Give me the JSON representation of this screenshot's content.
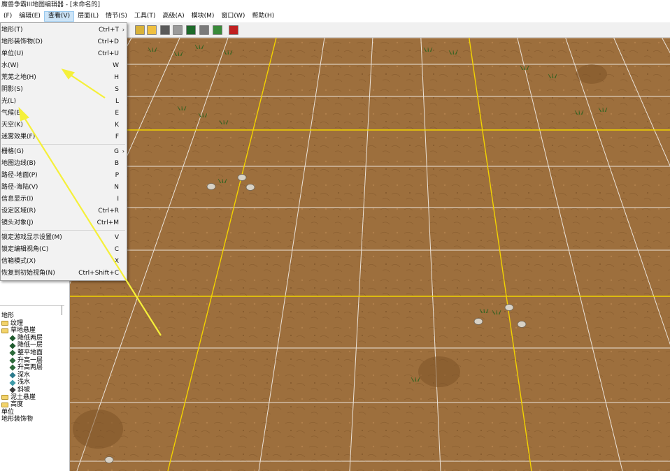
{
  "window": {
    "title": "魔兽争霸III地图编辑器 - [未命名的]"
  },
  "menubar": [
    {
      "label": "(F)",
      "active": false
    },
    {
      "label": "编辑(E)",
      "active": false
    },
    {
      "label": "查看(V)",
      "active": true
    },
    {
      "label": "层面(L)",
      "active": false
    },
    {
      "label": "情节(S)",
      "active": false
    },
    {
      "label": "工具(T)",
      "active": false
    },
    {
      "label": "高级(A)",
      "active": false
    },
    {
      "label": "模块(M)",
      "active": false
    },
    {
      "label": "窗口(W)",
      "active": false
    },
    {
      "label": "帮助(H)",
      "active": false
    }
  ],
  "view_menu": {
    "items": [
      {
        "label": "地形(T)",
        "shortcut": "Ctrl+T",
        "submenu": true
      },
      {
        "label": "地形装饰物(D)",
        "shortcut": "Ctrl+D"
      },
      {
        "label": "单位(U)",
        "shortcut": "Ctrl+U"
      },
      {
        "label": "水(W)",
        "shortcut": "W"
      },
      {
        "label": "荒芜之地(H)",
        "shortcut": "H"
      },
      {
        "label": "阴影(S)",
        "shortcut": "S"
      },
      {
        "label": "光(L)",
        "shortcut": "L"
      },
      {
        "label": "气候(E)",
        "shortcut": "E"
      },
      {
        "label": "天空(K)",
        "shortcut": "K"
      },
      {
        "label": "迷雾效果(F)",
        "shortcut": "F"
      },
      {
        "label": "栅格(G)",
        "shortcut": "G",
        "submenu": true
      },
      {
        "label": "地图边线(B)",
        "shortcut": "B"
      },
      {
        "label": "路径-地面(P)",
        "shortcut": "P"
      },
      {
        "label": "路径-海陆(V)",
        "shortcut": "N"
      },
      {
        "label": "信息显示(I)",
        "shortcut": "I"
      },
      {
        "label": "设定区域(R)",
        "shortcut": "Ctrl+R"
      },
      {
        "label": "镜头对象(J)",
        "shortcut": "Ctrl+M"
      },
      {
        "label": "锁定游戏显示设置(M)",
        "shortcut": "V"
      },
      {
        "label": "锁定编辑视角(C)",
        "shortcut": "C"
      },
      {
        "label": "信箱模式(X)",
        "shortcut": "X"
      },
      {
        "label": "恢复到初始视角(N)",
        "shortcut": "Ctrl+Shift+C"
      }
    ]
  },
  "tree": {
    "root": "地形",
    "nodes": [
      {
        "label": "纹理",
        "type": "folder"
      },
      {
        "label": "草地悬崖",
        "type": "folder"
      },
      {
        "label": "降低两层",
        "type": "tool",
        "color": "#1f5a2e"
      },
      {
        "label": "降低一层",
        "type": "tool",
        "color": "#1f5a2e"
      },
      {
        "label": "整平地面",
        "type": "tool",
        "color": "#2d6b3a"
      },
      {
        "label": "升高一层",
        "type": "tool",
        "color": "#2d6b3a"
      },
      {
        "label": "升高两层",
        "type": "tool",
        "color": "#2d6b3a"
      },
      {
        "label": "深水",
        "type": "tool",
        "color": "#2c7a8c"
      },
      {
        "label": "浅水",
        "type": "tool",
        "color": "#3e9aa8"
      },
      {
        "label": "斜坡",
        "type": "tool",
        "color": "#3d3d3d"
      },
      {
        "label": "泥土悬崖",
        "type": "folder"
      },
      {
        "label": "高度",
        "type": "folder"
      },
      {
        "label": "单位",
        "type": "plain"
      },
      {
        "label": "地形装饰物",
        "type": "plain"
      }
    ]
  },
  "colors": {
    "ground": "#9a6c3a",
    "grid_line": "#ffffff",
    "region_line": "#f2d300",
    "annotation_arrow": "#f5f03a",
    "menu_highlight": "#cce4f7"
  }
}
